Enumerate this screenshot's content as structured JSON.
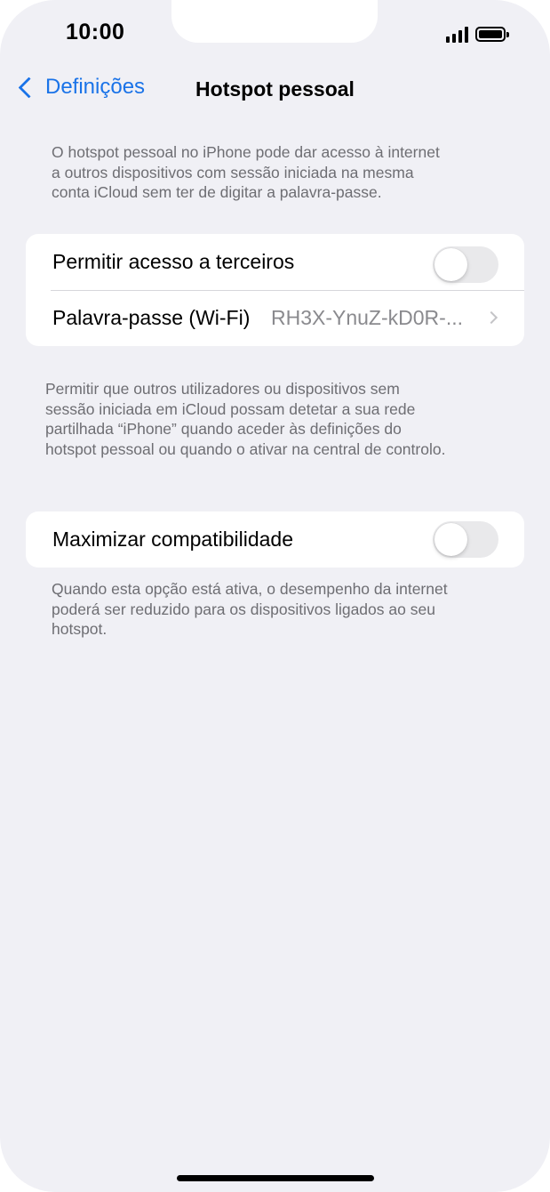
{
  "status_bar": {
    "time": "10:00",
    "signal_icon": "signal-bars-icon",
    "battery_icon": "battery-full-icon"
  },
  "nav": {
    "back_label": "Definições",
    "back_icon": "chevron-left-icon",
    "title": "Hotspot pessoal"
  },
  "intro_text": [
    "O hotspot pessoal no iPhone pode dar acesso à internet",
    "a outros dispositivos com sessão iniciada na mesma",
    "conta iCloud sem ter de digitar a palavra-passe."
  ],
  "access_group": {
    "allow_others_label": "Permitir acesso a terceiros",
    "allow_others_on": false,
    "password_label": "Palavra-passe (Wi-Fi)",
    "password_value": "RH3X-YnuZ-kD0R-...",
    "password_chevron_icon": "chevron-right-icon"
  },
  "access_footnote": [
    "Permitir que outros utilizadores ou dispositivos sem",
    "sessão iniciada em iCloud possam detetar a sua rede",
    "partilhada “iPhone” quando aceder às definições do",
    "hotspot pessoal ou quando o ativar na central de controlo."
  ],
  "compat_group": {
    "maximize_label": "Maximizar compatibilidade",
    "maximize_on": false
  },
  "compat_footnote": [
    "Quando esta opção está ativa, o desempenho da internet",
    "poderá ser reduzido para os dispositivos ligados ao seu",
    "hotspot."
  ],
  "colors": {
    "background": "#f0f0f5",
    "accent": "#1a73e8",
    "toggle_off": "#e9e9eb",
    "secondary_text": "#6e6e73"
  }
}
